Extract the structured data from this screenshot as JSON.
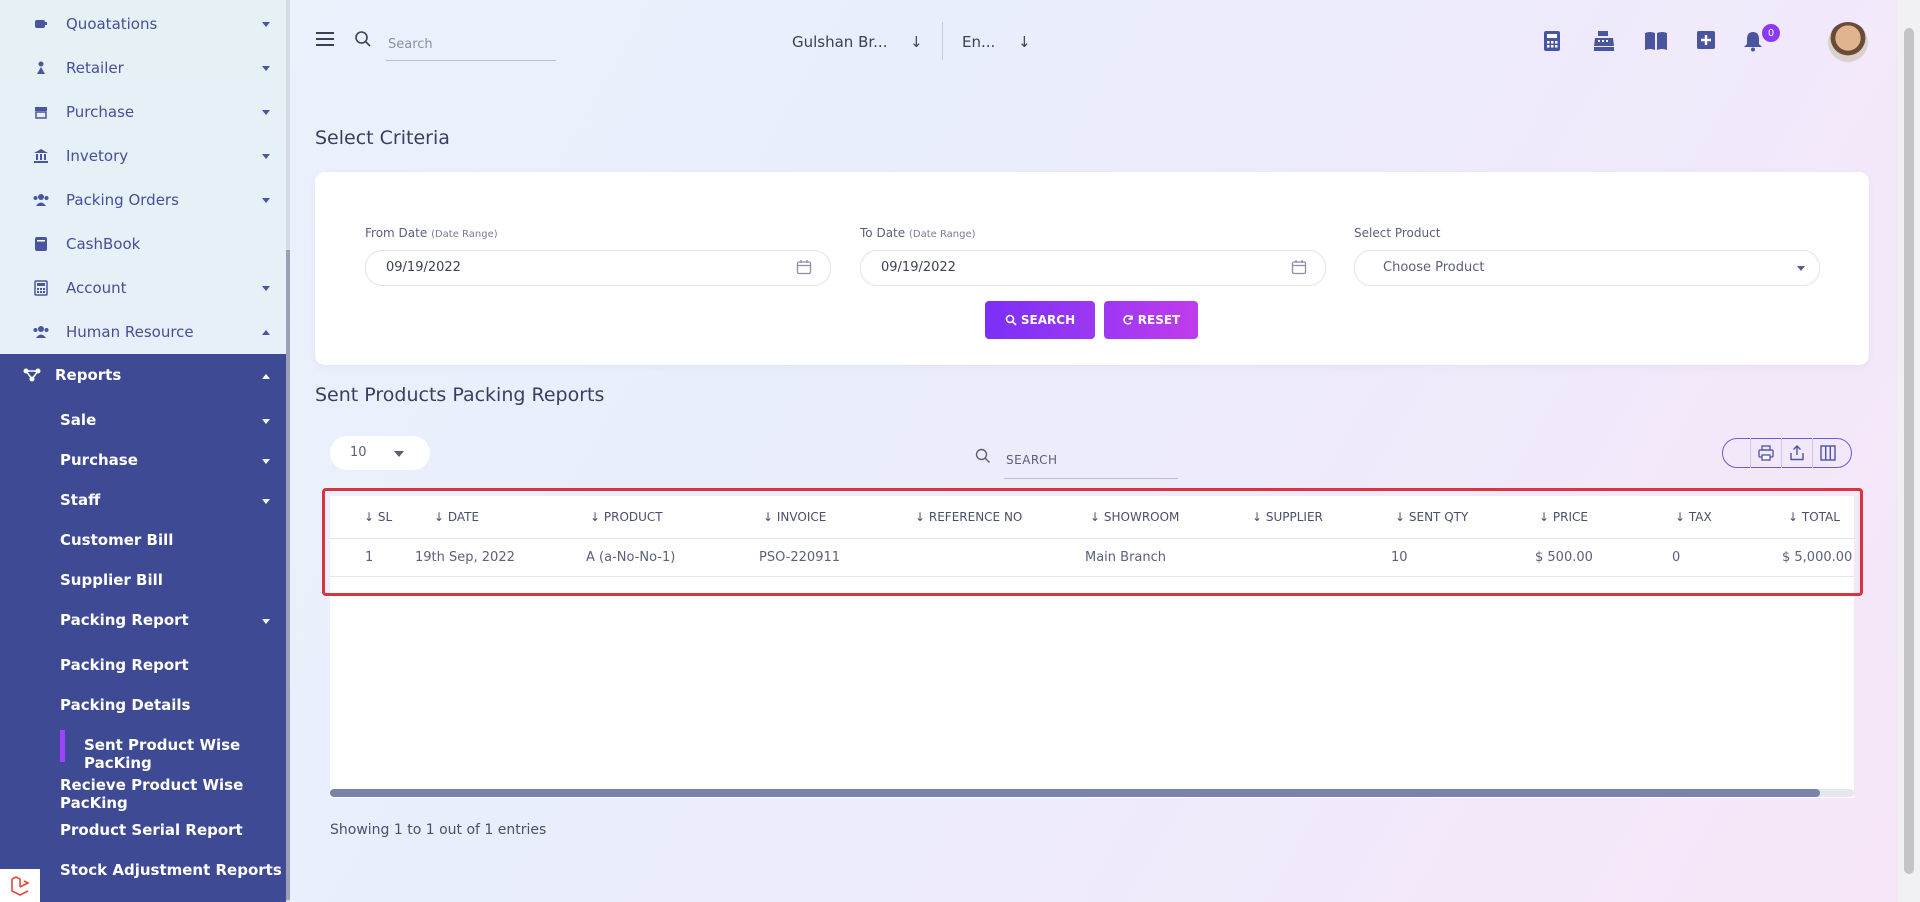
{
  "sidebar": {
    "items": [
      {
        "label": "Quoatations",
        "icon": "quotation-icon"
      },
      {
        "label": "Retailer",
        "icon": "retailer-icon"
      },
      {
        "label": "Purchase",
        "icon": "store-icon"
      },
      {
        "label": "Invetory",
        "icon": "bank-icon"
      },
      {
        "label": "Packing Orders",
        "icon": "users-icon"
      },
      {
        "label": "CashBook",
        "icon": "book-icon"
      },
      {
        "label": "Account",
        "icon": "calculator-icon"
      },
      {
        "label": "Human Resource",
        "icon": "users-icon"
      }
    ],
    "reports": {
      "label": "Reports",
      "sub": {
        "sale": "Sale",
        "purchase": "Purchase",
        "staff": "Staff",
        "customer_bill": "Customer Bill",
        "supplier_bill": "Supplier Bill",
        "packing_report": "Packing Report",
        "packing_report_child": "Packing Report",
        "packing_details": "Packing Details",
        "sent_product_wise": "Sent Product Wise PacKing",
        "recieve_product_wise": "Recieve Product Wise PacKing",
        "product_serial": "Product Serial Report",
        "stock_adjustment": "Stock Adjustment Reports"
      }
    }
  },
  "topbar": {
    "search_placeholder": "Search",
    "branch": "Gulshan Br...",
    "language": "En...",
    "notification_count": "0"
  },
  "criteria": {
    "title": "Select Criteria",
    "from_label": "From Date",
    "from_hint": "(Date Range)",
    "from_value": "09/19/2022",
    "to_label": "To Date",
    "to_hint": "(Date Range)",
    "to_value": "09/19/2022",
    "product_label": "Select Product",
    "product_value": "Choose Product",
    "search_btn": "SEARCH",
    "reset_btn": "RESET"
  },
  "report": {
    "title": "Sent Products Packing Reports",
    "page_length": "10",
    "search_placeholder": "SEARCH",
    "columns": [
      "SL",
      "DATE",
      "PRODUCT",
      "INVOICE",
      "REFERENCE NO",
      "SHOWROOM",
      "SUPPLIER",
      "SENT QTY",
      "PRICE",
      "TAX",
      "TOTAL"
    ],
    "rows": [
      {
        "sl": "1",
        "date": "19th Sep, 2022",
        "product": "A (a-No-No-1)",
        "invoice": "PSO-220911",
        "reference": "",
        "showroom": "Main Branch",
        "supplier": "",
        "qty": "10",
        "price": "$ 500.00",
        "tax": "0",
        "total": "$ 5,000.00"
      }
    ],
    "showing": "Showing 1 to 1 out of 1 entries"
  },
  "colors": {
    "sidebar_active": "#3f4a94",
    "accent_purple": "#8b39f5",
    "highlight": "#d9333d"
  }
}
